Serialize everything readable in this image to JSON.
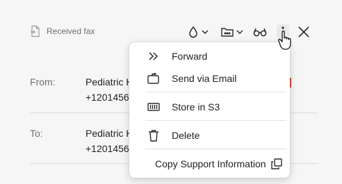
{
  "header": {
    "fax_label": "Received fax",
    "icons": [
      "fax-document-icon",
      "droplet-icon",
      "chevron-down-icon",
      "folder-tag-icon",
      "chevron-down-icon",
      "glasses-icon",
      "more-vertical-icon",
      "close-icon"
    ]
  },
  "fields": {
    "from_label": "From:",
    "from_name": "Pediatric H",
    "from_number": "+1201456",
    "to_label": "To:",
    "to_name": "Pediatric H",
    "to_number": "+1201456"
  },
  "menu": {
    "forward": "Forward",
    "send_email": "Send via Email",
    "store_s3": "Store in S3",
    "delete": "Delete",
    "copy_support": "Copy Support Information"
  },
  "colors": {
    "background": "#f6f6f6",
    "menu_background": "#ffffff",
    "accent_red": "#d34a3a"
  }
}
